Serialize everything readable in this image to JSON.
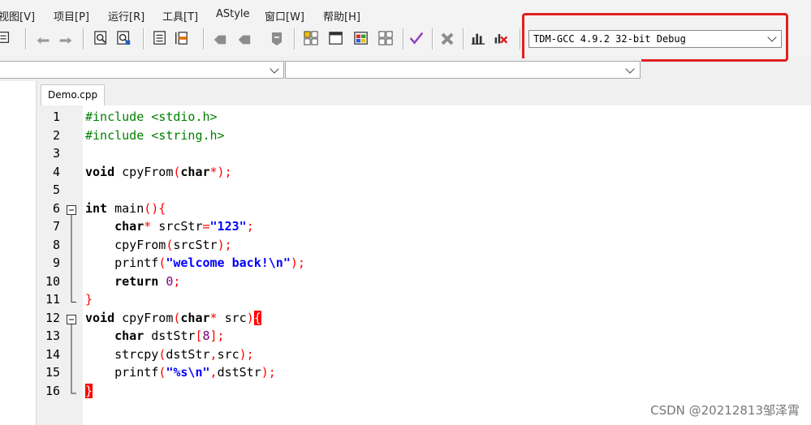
{
  "menubar": {
    "items": [
      "视图[V]",
      "项目[P]",
      "运行[R]",
      "工具[T]",
      "AStyle",
      "窗口[W]",
      "帮助[H]"
    ]
  },
  "toolbar": {
    "compiler_select": "TDM-GCC 4.9.2 32-bit Debug",
    "highlight_color": "#e02020"
  },
  "tabs": [
    {
      "label": "Demo.cpp",
      "active": true
    }
  ],
  "editor": {
    "line_numbers": [
      "1",
      "2",
      "3",
      "4",
      "5",
      "6",
      "7",
      "8",
      "9",
      "10",
      "11",
      "12",
      "13",
      "14",
      "15",
      "16"
    ],
    "lines": [
      [
        [
          "pp",
          "#include <stdio.h>"
        ]
      ],
      [
        [
          "pp",
          "#include <string.h>"
        ]
      ],
      [],
      [
        [
          "kw",
          "void"
        ],
        [
          "",
          " cpyFrom"
        ],
        [
          "op",
          "("
        ],
        [
          "kw",
          "char"
        ],
        [
          "op",
          "*);"
        ]
      ],
      [],
      [
        [
          "kw",
          "int"
        ],
        [
          "",
          " main"
        ],
        [
          "op",
          "(){"
        ]
      ],
      [
        [
          "",
          "    "
        ],
        [
          "kw",
          "char"
        ],
        [
          "op",
          "*"
        ],
        [
          "",
          " srcStr"
        ],
        [
          "op",
          "="
        ],
        [
          "str",
          "\"123\""
        ],
        [
          "op",
          ";"
        ]
      ],
      [
        [
          "",
          "    cpyFrom"
        ],
        [
          "op",
          "("
        ],
        [
          "",
          "srcStr"
        ],
        [
          "op",
          ");"
        ]
      ],
      [
        [
          "",
          "    printf"
        ],
        [
          "op",
          "("
        ],
        [
          "str",
          "\"welcome back!\\n\""
        ],
        [
          "op",
          ");"
        ]
      ],
      [
        [
          "",
          "    "
        ],
        [
          "kw",
          "return"
        ],
        [
          "",
          " "
        ],
        [
          "num",
          "0"
        ],
        [
          "op",
          ";"
        ]
      ],
      [
        [
          "op",
          "}"
        ]
      ],
      [
        [
          "kw",
          "void"
        ],
        [
          "",
          " cpyFrom"
        ],
        [
          "op",
          "("
        ],
        [
          "kw",
          "char"
        ],
        [
          "op",
          "*"
        ],
        [
          "",
          " src"
        ],
        [
          "op",
          ")"
        ],
        [
          "hl",
          "{"
        ]
      ],
      [
        [
          "",
          "    "
        ],
        [
          "kw",
          "char"
        ],
        [
          "",
          " dstStr"
        ],
        [
          "op",
          "["
        ],
        [
          "num",
          "8"
        ],
        [
          "op",
          "];"
        ]
      ],
      [
        [
          "",
          "    strcpy"
        ],
        [
          "op",
          "("
        ],
        [
          "",
          "dstStr"
        ],
        [
          "op",
          ","
        ],
        [
          "",
          "src"
        ],
        [
          "op",
          ");"
        ]
      ],
      [
        [
          "",
          "    printf"
        ],
        [
          "op",
          "("
        ],
        [
          "str",
          "\"%s\\n\""
        ],
        [
          "op",
          ","
        ],
        [
          "",
          "dstStr"
        ],
        [
          "op",
          ");"
        ]
      ],
      [
        [
          "hl",
          "}"
        ]
      ]
    ]
  },
  "watermark": "CSDN @20212813邹泽霄"
}
